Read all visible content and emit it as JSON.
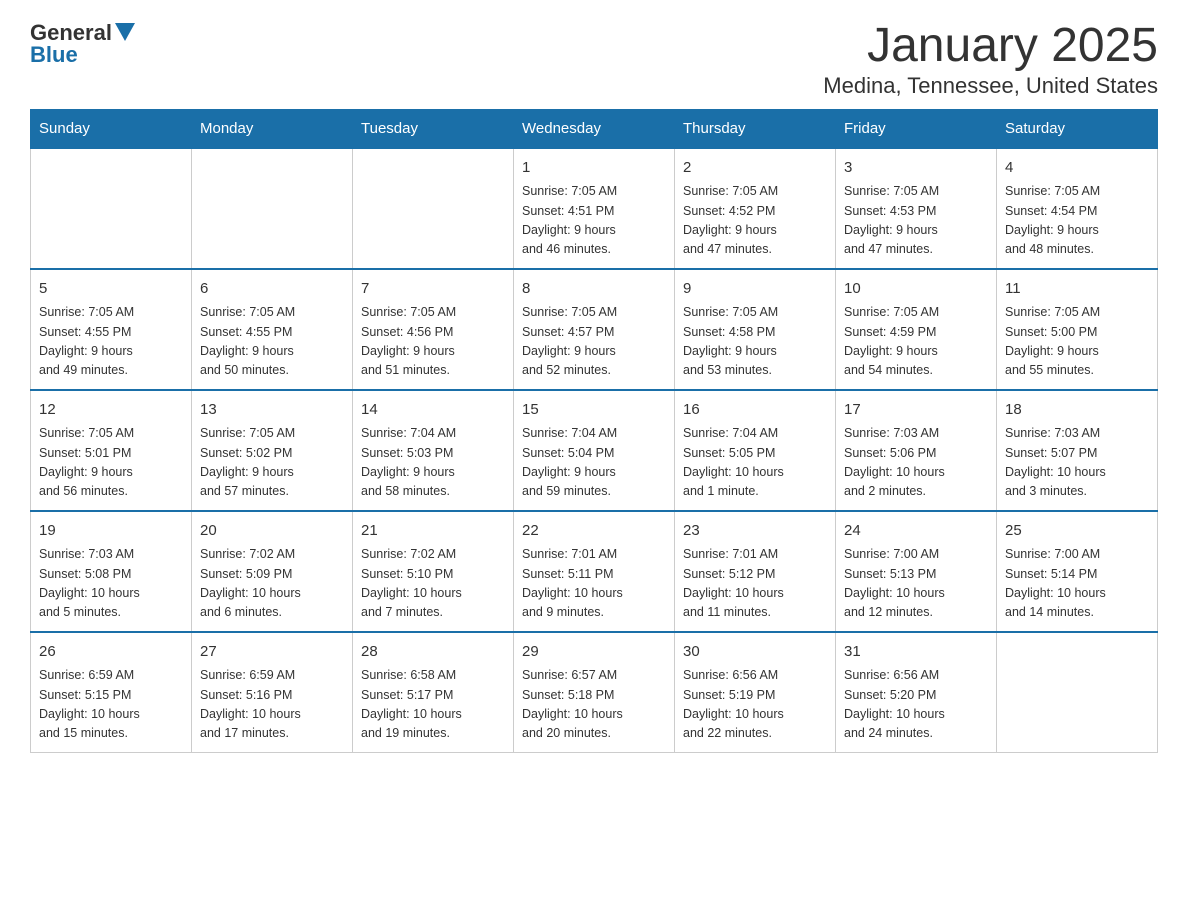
{
  "header": {
    "logo_general": "General",
    "logo_blue": "Blue",
    "title": "January 2025",
    "subtitle": "Medina, Tennessee, United States"
  },
  "calendar": {
    "days_of_week": [
      "Sunday",
      "Monday",
      "Tuesday",
      "Wednesday",
      "Thursday",
      "Friday",
      "Saturday"
    ],
    "weeks": [
      [
        {
          "day": "",
          "info": ""
        },
        {
          "day": "",
          "info": ""
        },
        {
          "day": "",
          "info": ""
        },
        {
          "day": "1",
          "info": "Sunrise: 7:05 AM\nSunset: 4:51 PM\nDaylight: 9 hours\nand 46 minutes."
        },
        {
          "day": "2",
          "info": "Sunrise: 7:05 AM\nSunset: 4:52 PM\nDaylight: 9 hours\nand 47 minutes."
        },
        {
          "day": "3",
          "info": "Sunrise: 7:05 AM\nSunset: 4:53 PM\nDaylight: 9 hours\nand 47 minutes."
        },
        {
          "day": "4",
          "info": "Sunrise: 7:05 AM\nSunset: 4:54 PM\nDaylight: 9 hours\nand 48 minutes."
        }
      ],
      [
        {
          "day": "5",
          "info": "Sunrise: 7:05 AM\nSunset: 4:55 PM\nDaylight: 9 hours\nand 49 minutes."
        },
        {
          "day": "6",
          "info": "Sunrise: 7:05 AM\nSunset: 4:55 PM\nDaylight: 9 hours\nand 50 minutes."
        },
        {
          "day": "7",
          "info": "Sunrise: 7:05 AM\nSunset: 4:56 PM\nDaylight: 9 hours\nand 51 minutes."
        },
        {
          "day": "8",
          "info": "Sunrise: 7:05 AM\nSunset: 4:57 PM\nDaylight: 9 hours\nand 52 minutes."
        },
        {
          "day": "9",
          "info": "Sunrise: 7:05 AM\nSunset: 4:58 PM\nDaylight: 9 hours\nand 53 minutes."
        },
        {
          "day": "10",
          "info": "Sunrise: 7:05 AM\nSunset: 4:59 PM\nDaylight: 9 hours\nand 54 minutes."
        },
        {
          "day": "11",
          "info": "Sunrise: 7:05 AM\nSunset: 5:00 PM\nDaylight: 9 hours\nand 55 minutes."
        }
      ],
      [
        {
          "day": "12",
          "info": "Sunrise: 7:05 AM\nSunset: 5:01 PM\nDaylight: 9 hours\nand 56 minutes."
        },
        {
          "day": "13",
          "info": "Sunrise: 7:05 AM\nSunset: 5:02 PM\nDaylight: 9 hours\nand 57 minutes."
        },
        {
          "day": "14",
          "info": "Sunrise: 7:04 AM\nSunset: 5:03 PM\nDaylight: 9 hours\nand 58 minutes."
        },
        {
          "day": "15",
          "info": "Sunrise: 7:04 AM\nSunset: 5:04 PM\nDaylight: 9 hours\nand 59 minutes."
        },
        {
          "day": "16",
          "info": "Sunrise: 7:04 AM\nSunset: 5:05 PM\nDaylight: 10 hours\nand 1 minute."
        },
        {
          "day": "17",
          "info": "Sunrise: 7:03 AM\nSunset: 5:06 PM\nDaylight: 10 hours\nand 2 minutes."
        },
        {
          "day": "18",
          "info": "Sunrise: 7:03 AM\nSunset: 5:07 PM\nDaylight: 10 hours\nand 3 minutes."
        }
      ],
      [
        {
          "day": "19",
          "info": "Sunrise: 7:03 AM\nSunset: 5:08 PM\nDaylight: 10 hours\nand 5 minutes."
        },
        {
          "day": "20",
          "info": "Sunrise: 7:02 AM\nSunset: 5:09 PM\nDaylight: 10 hours\nand 6 minutes."
        },
        {
          "day": "21",
          "info": "Sunrise: 7:02 AM\nSunset: 5:10 PM\nDaylight: 10 hours\nand 7 minutes."
        },
        {
          "day": "22",
          "info": "Sunrise: 7:01 AM\nSunset: 5:11 PM\nDaylight: 10 hours\nand 9 minutes."
        },
        {
          "day": "23",
          "info": "Sunrise: 7:01 AM\nSunset: 5:12 PM\nDaylight: 10 hours\nand 11 minutes."
        },
        {
          "day": "24",
          "info": "Sunrise: 7:00 AM\nSunset: 5:13 PM\nDaylight: 10 hours\nand 12 minutes."
        },
        {
          "day": "25",
          "info": "Sunrise: 7:00 AM\nSunset: 5:14 PM\nDaylight: 10 hours\nand 14 minutes."
        }
      ],
      [
        {
          "day": "26",
          "info": "Sunrise: 6:59 AM\nSunset: 5:15 PM\nDaylight: 10 hours\nand 15 minutes."
        },
        {
          "day": "27",
          "info": "Sunrise: 6:59 AM\nSunset: 5:16 PM\nDaylight: 10 hours\nand 17 minutes."
        },
        {
          "day": "28",
          "info": "Sunrise: 6:58 AM\nSunset: 5:17 PM\nDaylight: 10 hours\nand 19 minutes."
        },
        {
          "day": "29",
          "info": "Sunrise: 6:57 AM\nSunset: 5:18 PM\nDaylight: 10 hours\nand 20 minutes."
        },
        {
          "day": "30",
          "info": "Sunrise: 6:56 AM\nSunset: 5:19 PM\nDaylight: 10 hours\nand 22 minutes."
        },
        {
          "day": "31",
          "info": "Sunrise: 6:56 AM\nSunset: 5:20 PM\nDaylight: 10 hours\nand 24 minutes."
        },
        {
          "day": "",
          "info": ""
        }
      ]
    ]
  }
}
